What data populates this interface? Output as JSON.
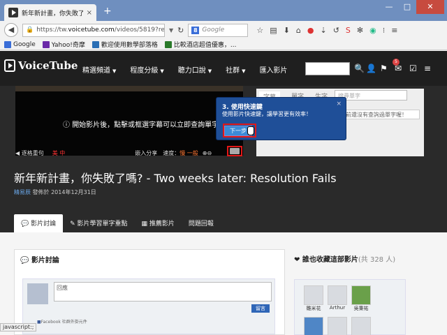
{
  "browser": {
    "tab_title": "新年新計畫，你失敗了嗎?",
    "tab_close": "×",
    "new_tab": "+",
    "window_buttons": [
      "—",
      "□",
      "✕"
    ],
    "url_prefix": "https://tw.",
    "url_domain": "voicetube.com",
    "url_rest": "/videos/5819?ref=transl",
    "search_engine": "8",
    "search_placeholder": "Google",
    "bookmarks": [
      {
        "label": "Google",
        "color": "#3a6ed8"
      },
      {
        "label": "Yahoo!奇摩",
        "color": "#6b2aa8"
      },
      {
        "label": "歡迎使用數學部落格",
        "color": "#2b6fb5"
      },
      {
        "label": "比較酒店超值優惠，...",
        "color": "#2a7a2a"
      }
    ],
    "status_text": "javascript:;"
  },
  "site": {
    "logo": "VoiceTube",
    "nav": [
      "精選頻道",
      "程度分級",
      "聽力口說",
      "社群",
      "匯入影片"
    ],
    "notification_count": "5",
    "video_message": "開始影片後，點擊或框選字幕可以立即查詢單字",
    "controls": {
      "prev": "◀ 逐格重句",
      "loop": "美 中",
      "share": "嵌入分享",
      "speed_label": "速度：",
      "speed_value": "慢 一般"
    },
    "side_tabs": [
      "字幕",
      "單字",
      "生字"
    ],
    "side_search_placeholder": "搜尋單字",
    "side_empty": "你目前還沒有查詢過單字喔！",
    "tooltip": {
      "title": "3. 使用快速鍵",
      "text": "使用影片快速鍵，讓學習更有效率！",
      "next": "下一步",
      "close": "×"
    },
    "video_title": "新年新計畫，你失敗了嗎? - Two weeks later: Resolution Fails",
    "author": "精易辰",
    "published": "發佈於 2014年12月31日",
    "content_tabs": [
      "影片討論",
      "影片學習單字重點",
      "推薦影片",
      "問題回報"
    ],
    "discussion_header": "影片討論",
    "comment_placeholder": "回應",
    "submit_label": "留言",
    "fb_plugin": "Facebook 社群外掛元件",
    "favorites_header": "誰也收藏這部影片",
    "favorites_count": "(共 328 人)",
    "favorites": [
      "雛米花",
      "Arthur",
      "吳秉祐",
      "",
      "",
      ""
    ]
  }
}
